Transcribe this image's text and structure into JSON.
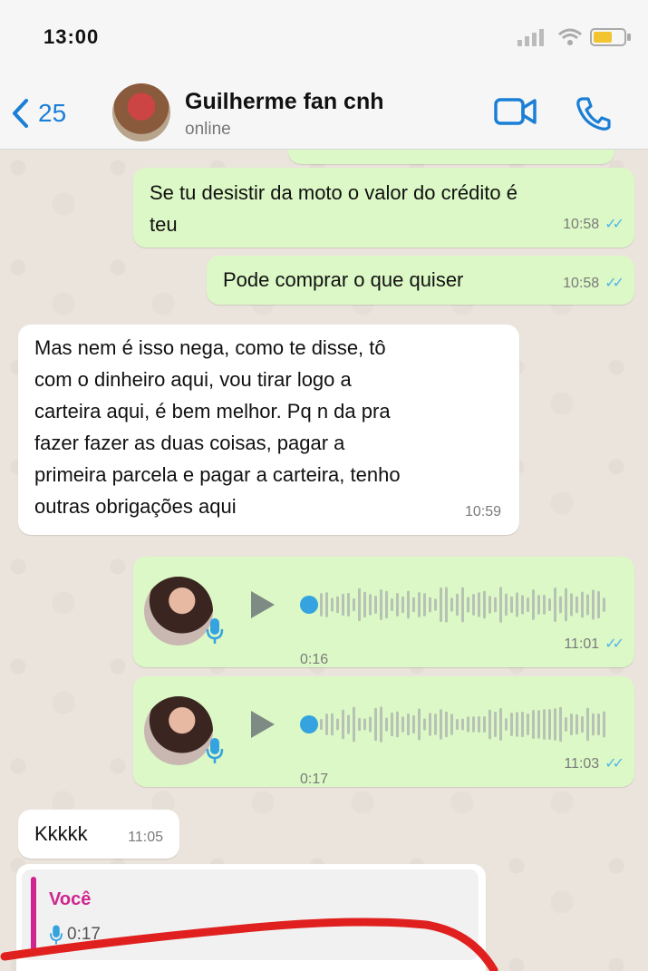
{
  "status_bar": {
    "time": "13:00"
  },
  "header": {
    "back_count": "25",
    "contact_name": "Guilherme fan cnh",
    "contact_status": "online"
  },
  "messages": [
    {
      "type": "text",
      "direction": "out",
      "text_line1": "Se tu desistir da moto o valor do crédito é",
      "text_line2": "teu",
      "time": "10:58"
    },
    {
      "type": "text",
      "direction": "out",
      "text": "Pode comprar o que quiser",
      "time": "10:58"
    },
    {
      "type": "text",
      "direction": "in",
      "lines": [
        "Mas nem é isso nega, como te disse, tô",
        "com o dinheiro aqui, vou tirar logo a",
        "carteira aqui, é bem melhor. Pq n da pra",
        "fazer fazer as duas coisas, pagar a",
        "primeira parcela e pagar a carteira, tenho",
        "outras obrigações aqui"
      ],
      "time": "10:59"
    },
    {
      "type": "voice",
      "direction": "out",
      "duration": "0:16",
      "time": "11:01"
    },
    {
      "type": "voice",
      "direction": "out",
      "duration": "0:17",
      "time": "11:03"
    },
    {
      "type": "text",
      "direction": "in",
      "text": "Kkkkk",
      "time": "11:05"
    },
    {
      "type": "reply",
      "direction": "in",
      "quoted_author": "Você",
      "quoted_duration": "0:17"
    }
  ],
  "colors": {
    "outgoing_bubble": "#dcf8c6",
    "incoming_bubble": "#ffffff",
    "accent": "#1a7fd6",
    "read_ticks": "#4fb6ec",
    "reply_accent": "#d0258f",
    "annotation_red": "#e0201e"
  },
  "icons": [
    "chevron-left-icon",
    "video-call-icon",
    "phone-icon",
    "play-icon",
    "mic-icon",
    "double-check-icon",
    "wifi-icon",
    "battery-icon",
    "signal-icon"
  ]
}
